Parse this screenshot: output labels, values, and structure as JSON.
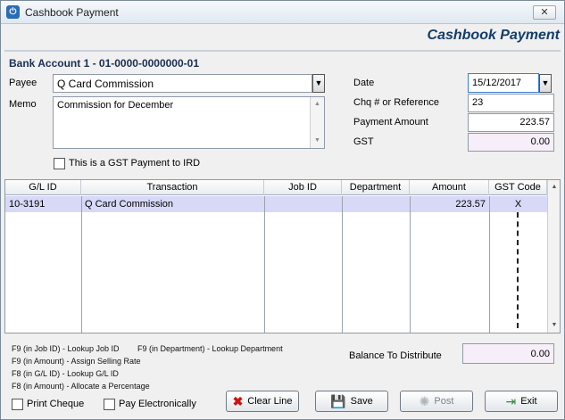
{
  "window": {
    "title": "Cashbook Payment",
    "app_icon": "power-icon",
    "close_glyph": "✕"
  },
  "form": {
    "header": "Cashbook Payment",
    "bank_account": "Bank Account 1 - 01-0000-0000000-01",
    "payee": {
      "label": "Payee",
      "value": "Q Card Commission"
    },
    "memo": {
      "label": "Memo",
      "value": "Commission for December"
    },
    "gst_ird": {
      "label": "This is a GST Payment to IRD",
      "checked": false
    },
    "date": {
      "label": "Date",
      "value": "15/12/2017"
    },
    "reference": {
      "label": "Chq # or Reference",
      "value": "23"
    },
    "payment_amount": {
      "label": "Payment Amount",
      "value": "223.57"
    },
    "gst": {
      "label": "GST",
      "value": "0.00"
    }
  },
  "grid": {
    "columns": [
      "G/L ID",
      "Transaction",
      "Job ID",
      "Department",
      "Amount",
      "GST Code"
    ],
    "rows": [
      {
        "gl_id": "10-3191",
        "transaction": "Q Card Commission",
        "job_id": "",
        "department": "",
        "amount": "223.57",
        "gst_code": "X"
      }
    ]
  },
  "hints": [
    "F9 (in Job ID) - Lookup Job ID",
    "F9 (in Department) - Lookup Department",
    "F9 (in Amount) - Assign Selling Rate",
    "F8 (in G/L ID) - Lookup G/L ID",
    "F8 (in Amount) - Allocate a Percentage"
  ],
  "balance": {
    "label": "Balance To Distribute",
    "value": "0.00"
  },
  "options": {
    "print_cheque": {
      "label": "Print Cheque",
      "checked": false
    },
    "pay_electronically": {
      "label": "Pay Electronically",
      "checked": false
    }
  },
  "buttons": {
    "clear_line": "Clear Line",
    "save": "Save",
    "post": "Post",
    "exit": "Exit"
  },
  "colors": {
    "header_text": "#143c6a",
    "row_highlight": "#d7d9f7",
    "readonly_field": "#f6eef8"
  }
}
